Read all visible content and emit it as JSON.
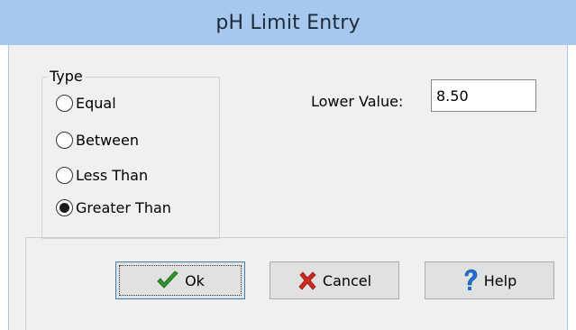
{
  "window": {
    "title": "pH Limit Entry"
  },
  "type_group": {
    "legend": "Type",
    "options": [
      {
        "label": "Equal",
        "selected": false
      },
      {
        "label": "Between",
        "selected": false
      },
      {
        "label": "Less Than",
        "selected": false
      },
      {
        "label": "Greater Than",
        "selected": true
      }
    ]
  },
  "lower_value": {
    "label": "Lower Value:",
    "value": "8.50"
  },
  "buttons": {
    "ok": "Ok",
    "cancel": "Cancel",
    "help": "Help"
  },
  "colors": {
    "titlebar": "#a7c8ee",
    "dialog_bg": "#f0f0f0",
    "ok_check": "#2e9a2e",
    "cancel_x": "#d02a1e",
    "help_q": "#1f6fd6"
  },
  "icons": {
    "ok": "checkmark-icon",
    "cancel": "x-icon",
    "help": "question-mark-icon"
  }
}
